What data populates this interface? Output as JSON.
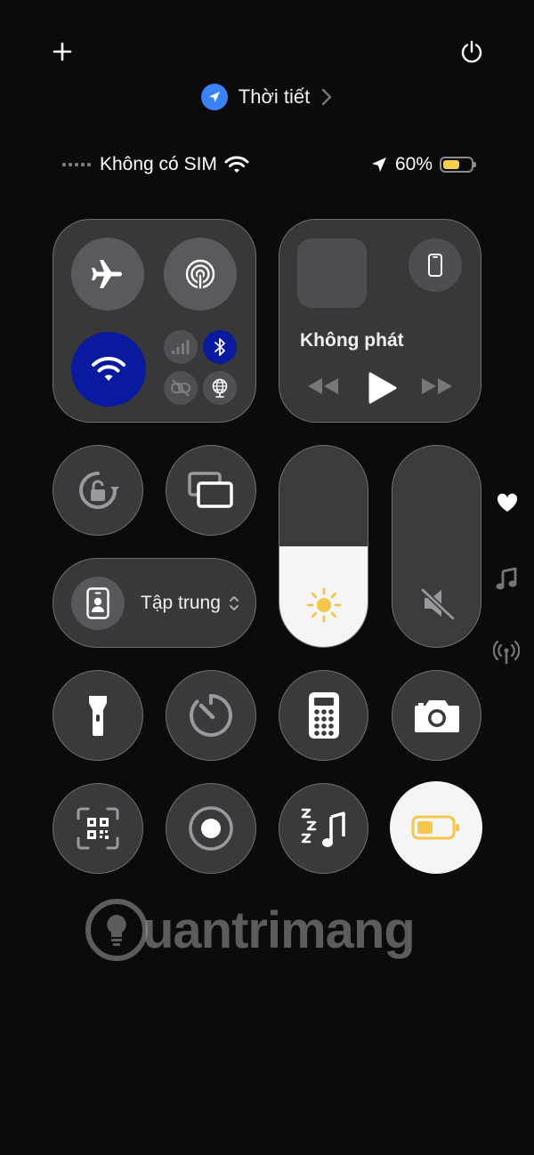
{
  "header": {
    "add_icon": "plus-icon",
    "power_icon": "power-icon",
    "weather_label": "Thời tiết"
  },
  "status_bar": {
    "carrier": "Không có SIM",
    "battery_percent": "60%",
    "battery_level": 0.6
  },
  "connectivity": {
    "airplane_mode": false,
    "airdrop": false,
    "wifi": true,
    "cellular": false,
    "bluetooth": true,
    "hotspot": false,
    "vpn_or_globe": false
  },
  "media": {
    "title": "Không phát"
  },
  "focus": {
    "label": "Tập trung"
  },
  "brightness": {
    "level": 0.5
  },
  "volume": {
    "level": 0.0,
    "muted": true
  },
  "colors": {
    "background": "#0b0b0d",
    "tile": "#38383b",
    "accent_blue": "#0a1a9e",
    "location_blue": "#3b82f6",
    "battery_yellow": "#f4d04a",
    "sun_yellow": "#f6c64a"
  },
  "watermark": {
    "text": "uantrimang"
  }
}
